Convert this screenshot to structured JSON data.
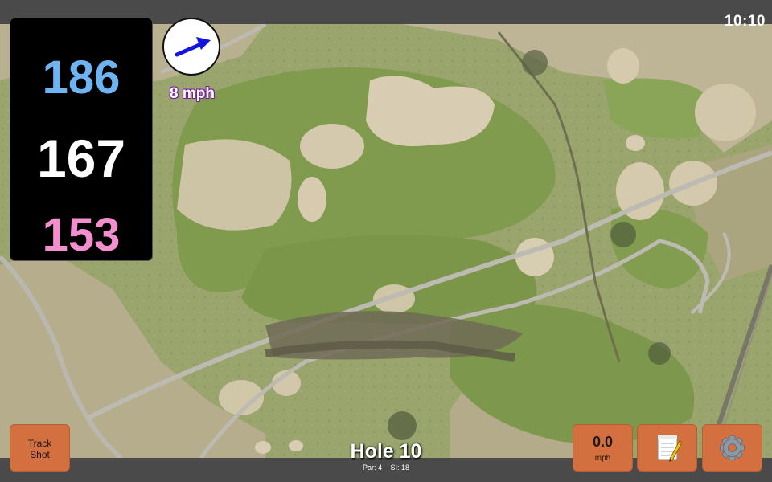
{
  "status_bar": {
    "time": "10:10"
  },
  "distances": {
    "back": "186",
    "center": "167",
    "front": "153"
  },
  "wind": {
    "speed_label": "8 mph",
    "icon": "wind-direction-arrow-icon"
  },
  "buttons": {
    "track_shot_line1": "Track",
    "track_shot_line2": "Shot",
    "speed_value": "0.0",
    "speed_unit": "mph",
    "notes_icon": "notepad-icon",
    "settings_icon": "gear-icon"
  },
  "hole": {
    "title": "Hole 10",
    "par_label": "Par: 4",
    "si_label": "SI: 18"
  },
  "colors": {
    "back_distance": "#6fb4f2",
    "center_distance": "#ffffff",
    "front_distance": "#f48fcf",
    "button": "#d4703f",
    "bar": "#4a4a4a"
  }
}
